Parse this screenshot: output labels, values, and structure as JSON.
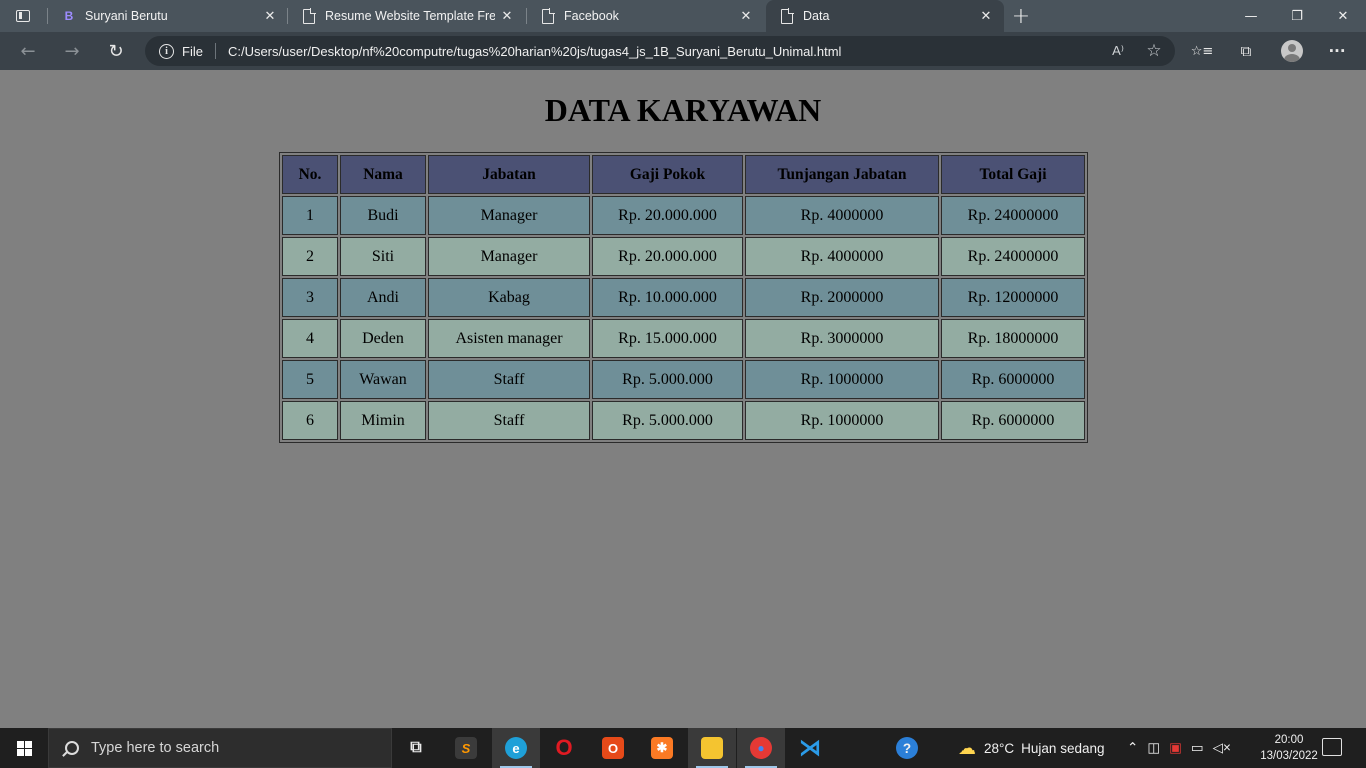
{
  "browser": {
    "tabs": [
      {
        "title": "Suryani Berutu",
        "icon": "bootstrap-b-icon",
        "icon_glyph": "B",
        "active": false
      },
      {
        "title": "Resume Website Template Free D",
        "icon": "page-icon",
        "active": false
      },
      {
        "title": "Facebook",
        "icon": "page-icon",
        "active": false
      },
      {
        "title": "Data",
        "icon": "page-icon",
        "active": true
      }
    ],
    "close_glyph": "✕",
    "new_tab_glyph": "+",
    "window_controls": {
      "minimize": "—",
      "restore": "❐",
      "close": "✕"
    },
    "address": {
      "scheme_label": "File",
      "url": "C:/Users/user/Desktop/nf%20computre/tugas%20harian%20js/tugas4_js_1B_Suryani_Berutu_Unimal.html"
    },
    "nav": {
      "back": "←",
      "forward": "→",
      "refresh": "↻"
    },
    "toolbar_icons": {
      "read_aloud": "A⁾",
      "favorite_add": "☆",
      "favorites": "☆≡",
      "collections": "⧉",
      "menu": "···"
    }
  },
  "page": {
    "title": "DATA KARYAWAN",
    "table": {
      "headers": [
        "No.",
        "Nama",
        "Jabatan",
        "Gaji Pokok",
        "Tunjangan Jabatan",
        "Total Gaji"
      ],
      "rows": [
        [
          "1",
          "Budi",
          "Manager",
          "Rp. 20.000.000",
          "Rp. 4000000",
          "Rp. 24000000"
        ],
        [
          "2",
          "Siti",
          "Manager",
          "Rp. 20.000.000",
          "Rp. 4000000",
          "Rp. 24000000"
        ],
        [
          "3",
          "Andi",
          "Kabag",
          "Rp. 10.000.000",
          "Rp. 2000000",
          "Rp. 12000000"
        ],
        [
          "4",
          "Deden",
          "Asisten manager",
          "Rp. 15.000.000",
          "Rp. 3000000",
          "Rp. 18000000"
        ],
        [
          "5",
          "Wawan",
          "Staff",
          "Rp. 5.000.000",
          "Rp. 1000000",
          "Rp. 6000000"
        ],
        [
          "6",
          "Mimin",
          "Staff",
          "Rp. 5.000.000",
          "Rp. 1000000",
          "Rp. 6000000"
        ]
      ]
    },
    "colors": {
      "header": "#4b5174",
      "row_odd": "#6f8f98",
      "row_even": "#93aca2",
      "background": "#808080"
    }
  },
  "taskbar": {
    "search_placeholder": "Type here to search",
    "apps": [
      {
        "name": "task-view-icon",
        "glyph": "⧉"
      },
      {
        "name": "sublime-text-icon",
        "glyph": "S",
        "color": "#ff9800"
      },
      {
        "name": "edge-icon",
        "glyph": "e",
        "color": "#1fa0d8",
        "active": true
      },
      {
        "name": "opera-icon",
        "glyph": "O",
        "color": "#e01a22"
      },
      {
        "name": "office-icon",
        "glyph": "O",
        "color": "#e64a19"
      },
      {
        "name": "xampp-icon",
        "glyph": "✱",
        "color": "#fb7a24"
      },
      {
        "name": "file-explorer-icon",
        "glyph": "▬",
        "color": "#f4c430",
        "active": true
      },
      {
        "name": "chrome-icon",
        "glyph": "●",
        "color": "#4caf50",
        "active": true
      },
      {
        "name": "vscode-icon",
        "glyph": "⋊",
        "color": "#2b9be8"
      }
    ],
    "weather": {
      "temperature": "28°C",
      "condition": "Hujan sedang"
    },
    "clock": {
      "time": "20:00",
      "date": "13/03/2022"
    }
  }
}
